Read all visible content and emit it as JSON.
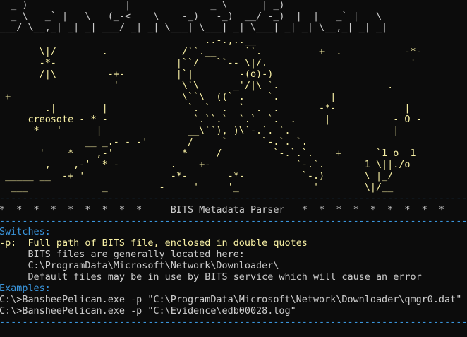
{
  "banner": {
    "lines": [
      "  _ )                 |              _ \\      | _)",
      "  _ \\   _` |   \\   (_-<    \\    -_)   -_)  __/ -_)  |  |   _` |   \\",
      "___/ \\__,_| _| _| ___/ _| _| \\___| \\___| _| \\___| _| _| \\__,_| _| _|"
    ]
  },
  "art": {
    "lines": [
      "                                    ..-.,..__",
      "       \\|/        .             /``.__     ``.          +  .           -*-",
      "       -*-                     |``/   ``-- \\|/.                         '",
      "       /|\\         -+-         |`|        -(o)-)",
      "                    '           \\`\\      _'/|\\ `.                   .",
      " +                              \\``\\  ((` .    `.         |",
      "        .|        |              `. `  .  `  .  .       -*-            |",
      "     creosote - * -               `.``.`  `.`  `.  .     |           - O -",
      "      *   '      |               __\\``), )\\`-.`. `.                  |",
      "               __ _.- - -'       /     `      `-.`. `.",
      "       '    *    ,-'            *     /         `-.`.`.    +      `1 o  1",
      "        ,    ,-'  * -         .    +-               `-.`.       1 \\||./o",
      " _____ __  -+ '               -*-       -*-          `-.)       \\ |_/",
      "  ___             _         -     '     '_             '        \\|/__"
    ]
  },
  "separator": "-----------------------------------------------------------------------------------",
  "title_row": "*  *  *  *  *  *  *  *  *     BITS Metadata Parser   *  *  *  *  *  *  *  *  *",
  "switches": {
    "heading": "Switches:",
    "flag": "-p:",
    "flag_desc": "  Full path of BITS file, enclosed in double quotes",
    "notes": [
      "     BITS files are generally located here:",
      "     C:\\ProgramData\\Microsoft\\Network\\Downloader\\",
      "     Default files may be in use by BITS service which will cause an error"
    ]
  },
  "examples": {
    "heading": "Examples:",
    "commands": [
      "C:\\>BansheePelican.exe -p \"C:\\ProgramData\\Microsoft\\Network\\Downloader\\qmgr0.dat\"",
      "C:\\>BansheePelican.exe -p \"C:\\Evidence\\edb00028.log\""
    ]
  },
  "colors": {
    "background": "#0c0c0c",
    "text": "#cccccc",
    "ascii_art": "#f9f1a5",
    "headings": "#3a96dd",
    "separator": "#3a96dd"
  }
}
